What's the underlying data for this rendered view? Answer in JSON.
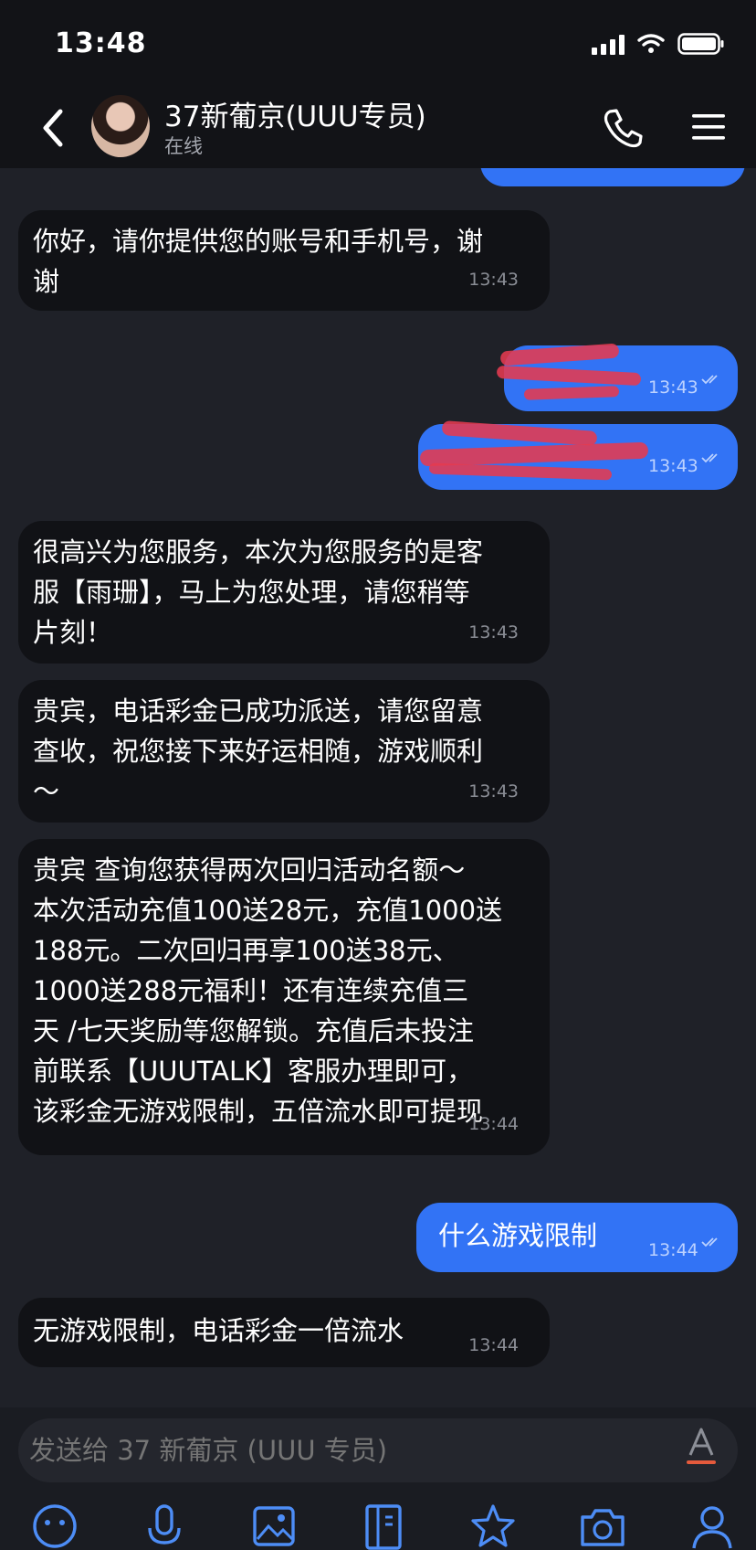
{
  "status_bar": {
    "time": "13:48"
  },
  "header": {
    "title": "37新葡京(UUU专员)",
    "status": "在线"
  },
  "messages": [
    {
      "text": "你好，请你提供您的账号和手机号，谢\n谢",
      "time": "13:43"
    },
    {
      "text": "",
      "time": "13:43"
    },
    {
      "text": "",
      "time": "13:43"
    },
    {
      "text": "很高兴为您服务，本次为您服务的是客\n服【雨珊】，马上为您处理，请您稍等\n片刻！",
      "time": "13:43"
    },
    {
      "text": "贵宾，电话彩金已成功派送，请您留意\n查收，祝您接下来好运相随，游戏顺利\n～",
      "time": "13:43"
    },
    {
      "text": "贵宾  查询您获得两次回归活动名额～\n本次活动充值100送28元，充值1000送\n188元。二次回归再享100送38元、\n1000送288元福利！还有连续充值三\n天 /七天奖励等您解锁。充值后未投注\n前联系【UUUTALK】客服办理即可，\n该彩金无游戏限制，五倍流水即可提现",
      "time": "13:44"
    },
    {
      "text": "什么游戏限制",
      "time": "13:44"
    },
    {
      "text": "无游戏限制，电话彩金一倍流水",
      "time": "13:44"
    }
  ],
  "input": {
    "placeholder": "发送给 37 新葡京 (UUU 专员)"
  },
  "toolbar": [
    "emoji-icon",
    "microphone-icon",
    "image-icon",
    "document-icon",
    "star-icon",
    "camera-icon",
    "user-icon"
  ],
  "colors": {
    "outgoing_bubble": "#3273f5",
    "incoming_bubble": "#111216",
    "background": "#1f2128"
  }
}
